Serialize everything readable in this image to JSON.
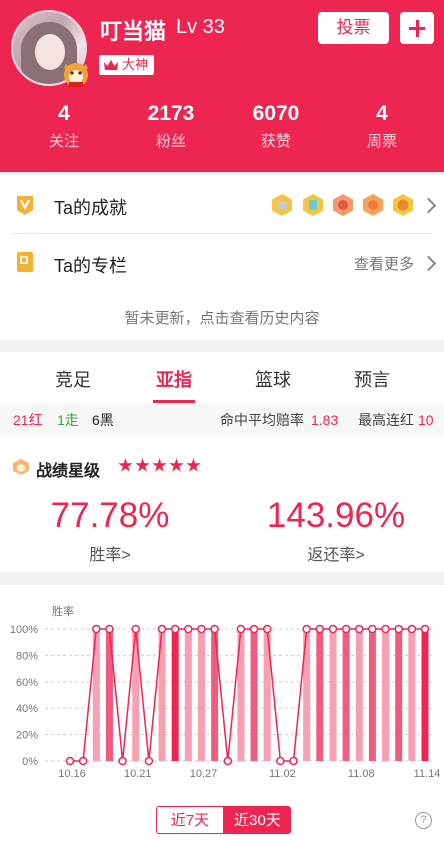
{
  "user": {
    "name": "叮当猫",
    "level": "Lv 33",
    "badge": "大神"
  },
  "header_actions": {
    "vote": "投票"
  },
  "stats": [
    {
      "value": "4",
      "label": "关注"
    },
    {
      "value": "2173",
      "label": "粉丝"
    },
    {
      "value": "6070",
      "label": "获赞"
    },
    {
      "value": "4",
      "label": "周票"
    }
  ],
  "achievements": {
    "title": "Ta的成就"
  },
  "column": {
    "title": "Ta的专栏",
    "more": "查看更多",
    "empty": "暂未更新，点击查看历史内容"
  },
  "tabs": [
    "竞足",
    "亚指",
    "篮球",
    "预言"
  ],
  "active_tab": "亚指",
  "record": {
    "red": "21红",
    "draw": "1走",
    "black": "6黑",
    "avg_odds_label": "命中平均赔率",
    "avg_odds": "1.83",
    "streak_label": "最高连红",
    "streak": "10"
  },
  "rating": {
    "title": "战绩星级",
    "stars": 5
  },
  "win_rate": {
    "value": "77.78%",
    "label": "胜率>"
  },
  "return_rate": {
    "value": "143.96%",
    "label": "返还率>"
  },
  "range_buttons": {
    "week": "近7天",
    "month": "近30天",
    "selected": "近30天"
  },
  "colors": {
    "brand": "#ec2651",
    "light_bar": "#f6a0b4",
    "mid_bar": "#ee5d80"
  },
  "chart_data": {
    "type": "bar",
    "ylabel": "胜率",
    "ylim": [
      0,
      100
    ],
    "yticks": [
      "0%",
      "20%",
      "40%",
      "60%",
      "80%",
      "100%"
    ],
    "xticks": [
      "10.16",
      "10.21",
      "10.27",
      "11.02",
      "11.08",
      "11.14"
    ],
    "grid": true,
    "values": [
      0,
      0,
      100,
      100,
      0,
      100,
      0,
      100,
      100,
      100,
      100,
      100,
      0,
      100,
      100,
      100,
      0,
      0,
      100,
      100,
      100,
      100,
      100,
      100,
      100,
      100,
      100,
      100
    ],
    "line": [
      0,
      0,
      100,
      100,
      0,
      100,
      0,
      100,
      100,
      100,
      100,
      100,
      0,
      100,
      100,
      100,
      0,
      0,
      100,
      100,
      100,
      100,
      100,
      100,
      100,
      100,
      100,
      100
    ],
    "shade": [
      "mid",
      "mid",
      "light",
      "mid",
      "mid",
      "light",
      "mid",
      "light",
      "brand",
      "light",
      "light",
      "mid",
      "mid",
      "light",
      "mid",
      "light",
      "mid",
      "mid",
      "light",
      "mid",
      "light",
      "mid",
      "light",
      "mid",
      "light",
      "mid",
      "light",
      "brand"
    ]
  }
}
